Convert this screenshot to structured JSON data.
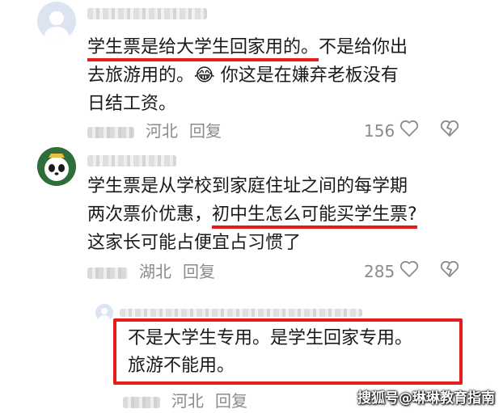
{
  "comments": [
    {
      "lines": [
        "学生票是给大学生回家用的。不是给你出",
        "去旅游用的。😂 你这是在嫌弃老板没有",
        "日结工资。"
      ],
      "highlight": "学生票是给大学生回家用的。",
      "highlight_rest": "不是给你出",
      "location": "河北",
      "reply_label": "回复",
      "likes": "156"
    },
    {
      "lines": [
        "学生票是从学校到家庭住址之间的每学期",
        "两次票价优惠，",
        "这家长可能占便宜占习惯了"
      ],
      "highlight": "初中生怎么可能买学生票?",
      "location": "湖北",
      "reply_label": "回复",
      "likes": "285"
    },
    {
      "lines": [
        "不是大学生专用。是学生回家专用。",
        "旅游不能用。"
      ],
      "location": "河北",
      "reply_label": "回复"
    }
  ],
  "watermark": "搜狐号@琳琳教育指南",
  "colors": {
    "highlight": "#e21d1d",
    "meta": "#8a8a8a",
    "text": "#1a1a1a"
  },
  "icons": [
    "heart-icon",
    "broken-heart-icon",
    "default-avatar-icon",
    "panda-avatar-icon"
  ]
}
